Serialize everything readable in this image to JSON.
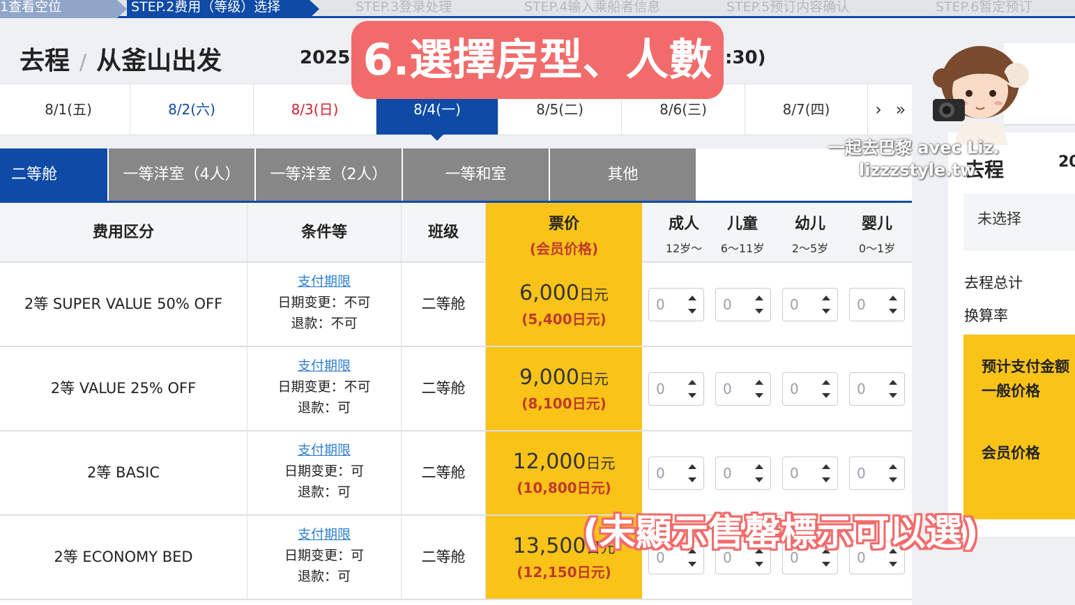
{
  "steps": [
    {
      "label": "1查看空位",
      "state": "done"
    },
    {
      "label": "STEP.2费用（等级）选择",
      "state": "active"
    },
    {
      "label": "STEP.3登录处理",
      "state": "todo"
    },
    {
      "label": "STEP.4输入乘船者信息",
      "state": "todo"
    },
    {
      "label": "STEP.5预订内容确认",
      "state": "todo"
    },
    {
      "label": "STEP.6暂定预订",
      "state": "todo"
    }
  ],
  "header": {
    "title": "去程",
    "separator": "/",
    "subtitle": "从釜山出发",
    "date_prefix": "2025-",
    "date_suffix": ":30)"
  },
  "date_tabs": [
    {
      "label": "8/1(五)",
      "type": "fri"
    },
    {
      "label": "8/2(六)",
      "type": "sat"
    },
    {
      "label": "8/3(日)",
      "type": "sun"
    },
    {
      "label": "8/4(一)",
      "type": "selected"
    },
    {
      "label": "8/5(二)",
      "type": "weekday"
    },
    {
      "label": "8/6(三)",
      "type": "weekday"
    },
    {
      "label": "8/7(四)",
      "type": "weekday"
    }
  ],
  "nav": {
    "next": "›",
    "last": "»"
  },
  "cabin_tabs": [
    "二等舱",
    "一等洋室（4人）",
    "一等洋室（2人）",
    "一等和室",
    "其他"
  ],
  "table": {
    "headers": {
      "fare": "费用区分",
      "conditions": "条件等",
      "class": "班级",
      "price_line1": "票价",
      "price_line2": "(会员价格)"
    },
    "pax": [
      {
        "label": "成人",
        "age": "12岁～"
      },
      {
        "label": "儿童",
        "age": "6～11岁"
      },
      {
        "label": "幼儿",
        "age": "2～5岁"
      },
      {
        "label": "婴儿",
        "age": "0～1岁"
      }
    ],
    "rows": [
      {
        "fare": "2等 SUPER VALUE 50% OFF",
        "link": "支付期限",
        "change": "日期变更：不可",
        "refund": "退款：不可",
        "class": "二等舱",
        "price": "6,000",
        "price_unit": "日元",
        "member": "(5,400日元)",
        "counts": [
          "0",
          "0",
          "0",
          "0"
        ]
      },
      {
        "fare": "2等 VALUE 25% OFF",
        "link": "支付期限",
        "change": "日期变更：不可",
        "refund": "退款：可",
        "class": "二等舱",
        "price": "9,000",
        "price_unit": "日元",
        "member": "(8,100日元)",
        "counts": [
          "0",
          "0",
          "0",
          "0"
        ]
      },
      {
        "fare": "2等 BASIC",
        "link": "支付期限",
        "change": "日期变更：可",
        "refund": "退款：可",
        "class": "二等舱",
        "price": "12,000",
        "price_unit": "日元",
        "member": "(10,800日元)",
        "counts": [
          "0",
          "0",
          "0",
          "0"
        ]
      },
      {
        "fare": "2等 ECONOMY BED",
        "link": "支付期限",
        "change": "日期变更：可",
        "refund": "退款：可",
        "class": "二等舱",
        "price": "13,500",
        "price_unit": "日元",
        "member": "(12,150日元)",
        "counts": [
          "0",
          "0",
          "0",
          "0"
        ]
      }
    ]
  },
  "sidebar": {
    "title": "去程",
    "year": "20",
    "unselected": "未选择",
    "total": "去程总计",
    "rate": "换算率",
    "estimate": "预计支付金额",
    "general": "一般价格",
    "member": "会员价格"
  },
  "overlay": {
    "banner": "6.選擇房型、人數",
    "note": "(未顯示售罄標示可以選)",
    "watermark_line1": "一起去巴黎 avec Liz.",
    "watermark_line2": "lizzzstyle.tw"
  },
  "colors": {
    "primary": "#0e4aa6",
    "price_bg": "#f9c318",
    "member_red": "#c0392b",
    "banner": "#f26b6b",
    "inactive_tab": "#878787"
  }
}
